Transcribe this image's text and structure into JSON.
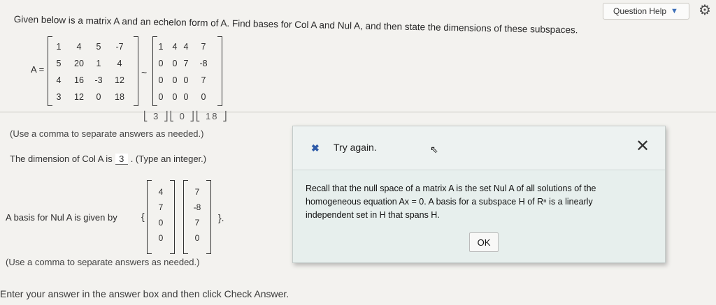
{
  "header": {
    "question_help": "Question Help",
    "question_help_caret": "▼",
    "settings_icon": "gear-icon"
  },
  "prompt": {
    "text": "Given below is a matrix A and an echelon form of A. Find bases for Col A and Nul A, and then state the dimensions of these subspaces.",
    "a_label": "A =",
    "tilde": "~"
  },
  "matrix_a": {
    "rows": [
      [
        "1",
        "4",
        "5",
        "-7"
      ],
      [
        "5",
        "20",
        "1",
        "4"
      ],
      [
        "4",
        "16",
        "-3",
        "12"
      ],
      [
        "3",
        "12",
        "0",
        "18"
      ]
    ]
  },
  "matrix_echelon": {
    "rows": [
      [
        "1",
        "4",
        "4",
        "7"
      ],
      [
        "0",
        "0",
        "7",
        "-8"
      ],
      [
        "0",
        "0",
        "0",
        "7"
      ],
      [
        "0",
        "0",
        "0",
        "0"
      ]
    ]
  },
  "cut_text": "⎣ 3 ⎦⎣  0 ⎦⎣ 18 ⎦",
  "instructions": {
    "comma_note": "(Use a comma to separate answers as needed.)",
    "dimension_prefix": "The dimension of Col A is",
    "dimension_value": "3",
    "dimension_suffix": ". (Type an integer.)",
    "basis_label": "A basis for Nul A is given by",
    "brace_open": "{",
    "brace_close": "}.",
    "comma_note2": "(Use a comma to separate answers as needed.)",
    "footer": "Enter your answer in the answer box and then click Check Answer."
  },
  "basis_vectors": {
    "v1": [
      "4",
      "7",
      "0",
      "0"
    ],
    "v2": [
      "7",
      "-8",
      "7",
      "0"
    ]
  },
  "feedback": {
    "status_icon": "x-icon",
    "status": "Try again.",
    "message": "Recall that the null space of a matrix A is the set Nul A of all solutions of the homogeneous equation Ax = 0. A basis for a subspace H of Rⁿ is a linearly independent set in H that spans H.",
    "ok_label": "OK",
    "close_label": "✕"
  },
  "colors": {
    "accent_blue": "#2d5aa8",
    "dialog_bg": "#e7efed"
  }
}
